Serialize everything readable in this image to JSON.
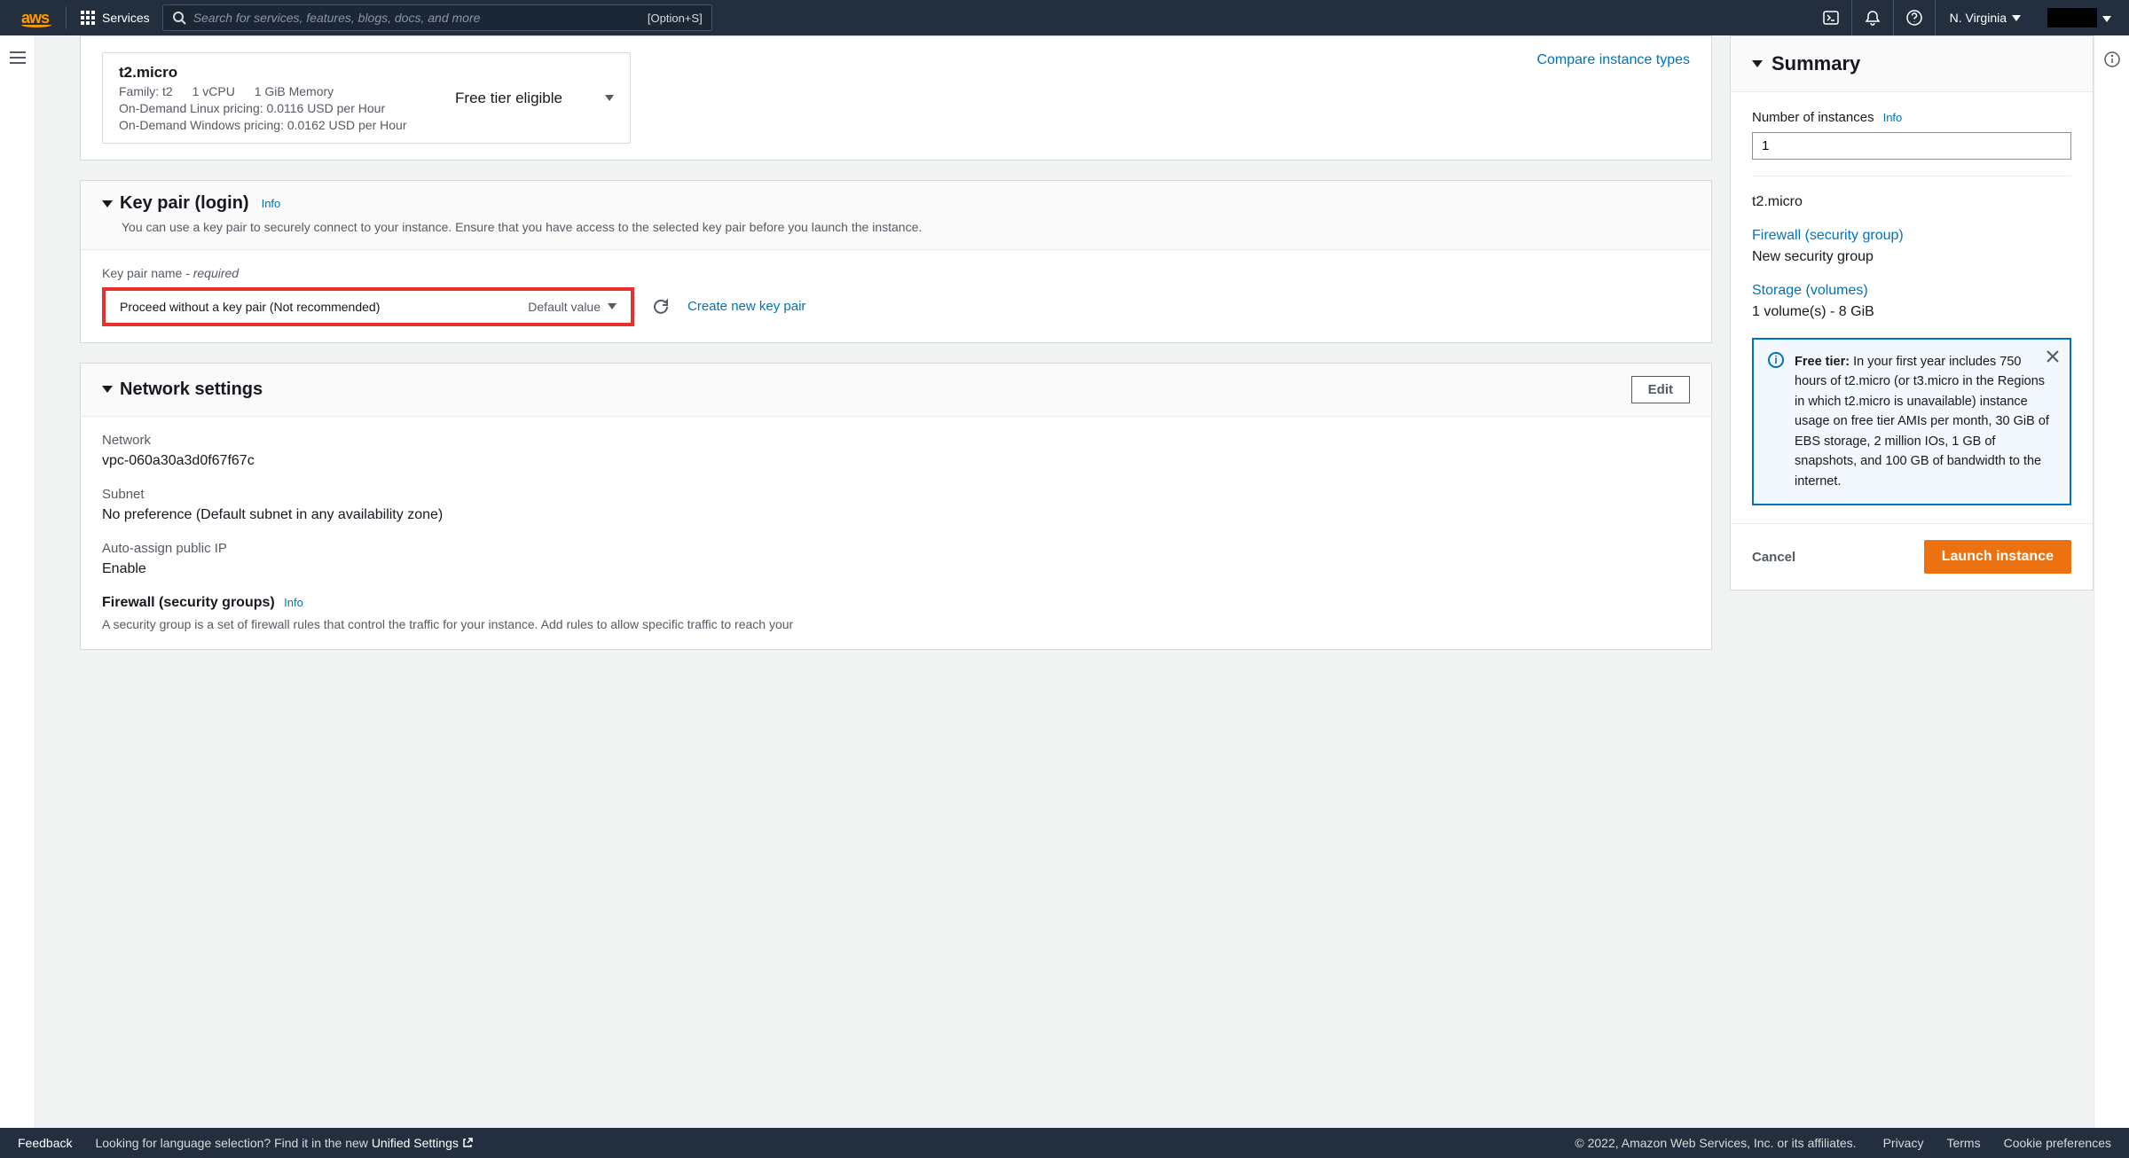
{
  "nav": {
    "logo": "aws",
    "services": "Services",
    "search_placeholder": "Search for services, features, blogs, docs, and more",
    "hotkey": "[Option+S]",
    "region": "N. Virginia"
  },
  "instance_type": {
    "title": "t2.micro",
    "family": "Family: t2",
    "vcpu": "1 vCPU",
    "memory": "1 GiB Memory",
    "linux_pricing": "On-Demand Linux pricing: 0.0116 USD per Hour",
    "windows_pricing": "On-Demand Windows pricing: 0.0162 USD per Hour",
    "free_tier": "Free tier eligible",
    "compare": "Compare instance types"
  },
  "key_pair": {
    "heading": "Key pair (login)",
    "info": "Info",
    "desc": "You can use a key pair to securely connect to your instance. Ensure that you have access to the selected key pair before you launch the instance.",
    "field_label": "Key pair name",
    "required": " - required",
    "select_value": "Proceed without a key pair (Not recommended)",
    "default_value": "Default value",
    "create_link": "Create new key pair"
  },
  "network": {
    "heading": "Network settings",
    "edit": "Edit",
    "network_label": "Network",
    "network_value": "vpc-060a30a3d0f67f67c",
    "subnet_label": "Subnet",
    "subnet_value": "No preference (Default subnet in any availability zone)",
    "public_ip_label": "Auto-assign public IP",
    "public_ip_value": "Enable",
    "firewall_title": "Firewall (security groups)",
    "firewall_info": "Info",
    "firewall_desc": "A security group is a set of firewall rules that control the traffic for your instance. Add rules to allow specific traffic to reach your"
  },
  "summary": {
    "heading": "Summary",
    "num_instances_label": "Number of instances",
    "num_instances_info": "Info",
    "num_instances_value": "1",
    "instance_type": "t2.micro",
    "firewall_link": "Firewall (security group)",
    "firewall_value": "New security group",
    "storage_link": "Storage (volumes)",
    "storage_value": "1 volume(s) - 8 GiB",
    "free_tier_label": "Free tier:",
    "free_tier_text": " In your first year includes 750 hours of t2.micro (or t3.micro in the Regions in which t2.micro is unavailable) instance usage on free tier AMIs per month, 30 GiB of EBS storage, 2 million IOs, 1 GB of snapshots, and 100 GB of bandwidth to the internet.",
    "cancel": "Cancel",
    "launch": "Launch instance"
  },
  "footer": {
    "feedback": "Feedback",
    "lang_text": "Looking for language selection? Find it in the new ",
    "unified": "Unified Settings",
    "copyright": "© 2022, Amazon Web Services, Inc. or its affiliates.",
    "privacy": "Privacy",
    "terms": "Terms",
    "cookie": "Cookie preferences"
  }
}
